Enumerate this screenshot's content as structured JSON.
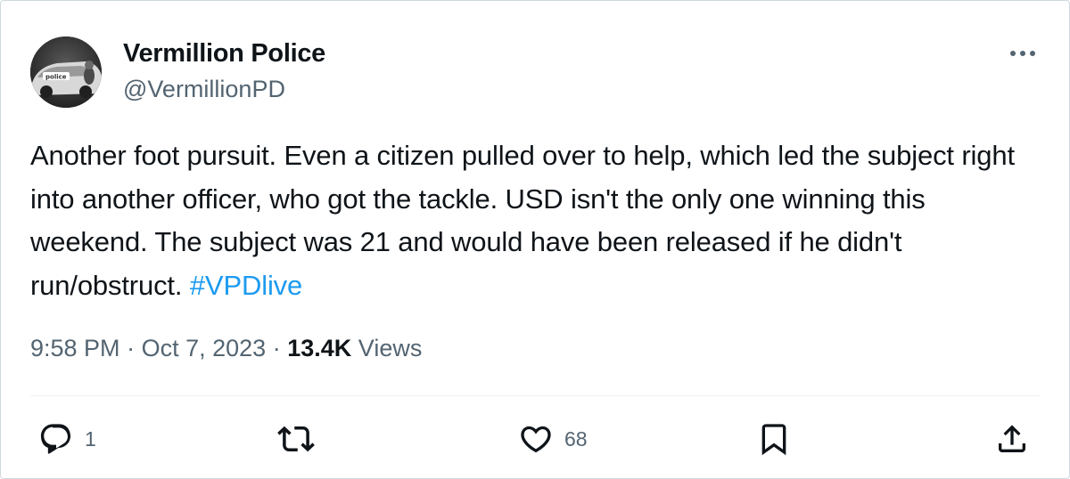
{
  "author": {
    "display_name": "Vermillion Police",
    "handle": "@VermillionPD",
    "avatar_badge": "police"
  },
  "tweet": {
    "text": "Another foot pursuit. Even a citizen pulled over to help, which led the subject right into another officer, who got the tackle. USD isn't the only one winning this weekend. The subject was 21 and would have been released if he didn't run/obstruct. ",
    "hashtag": "#VPDlive",
    "time": "9:58 PM",
    "date": "Oct 7, 2023",
    "separator": "·",
    "views_count": "13.4K",
    "views_label": "Views"
  },
  "actions": {
    "reply_count": "1",
    "retweet_count": "",
    "like_count": "68"
  },
  "icons": {
    "more": "more-horizontal-icon",
    "reply": "reply-icon",
    "retweet": "retweet-icon",
    "like": "heart-icon",
    "bookmark": "bookmark-icon",
    "share": "share-icon"
  },
  "colors": {
    "text_primary": "#0f1419",
    "text_secondary": "#536471",
    "hashtag": "#1d9bf0",
    "divider": "#eff3f4"
  }
}
